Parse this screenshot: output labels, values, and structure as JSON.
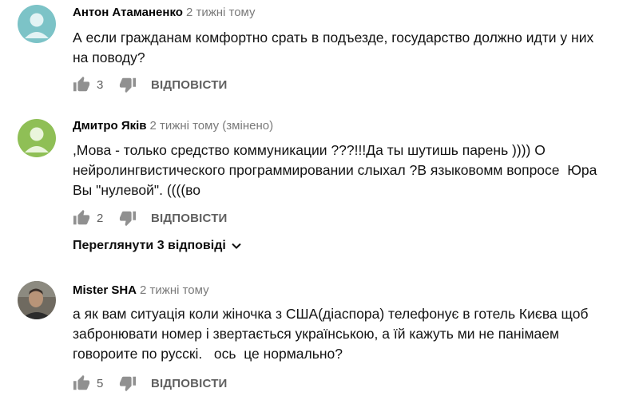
{
  "comments": [
    {
      "author": "Антон Атаманенко",
      "time": "2 тижні тому",
      "text": "А если гражданам комфортно срать в подъезде, государство должно идти у них на поводу?",
      "likes": "3",
      "reply_label": "ВІДПОВІСТИ",
      "avatar_color": "#7cc3c7"
    },
    {
      "author": "Дмитро Яків",
      "time": "2 тижні тому (змінено)",
      "text": ",Мова - только средство коммуникации ???!!!Да ты шутишь парень )))) О нейролингвистического программировании слыхал ?В языковомм вопросе  Юра Вы \"нулевой\". ((((во",
      "likes": "2",
      "reply_label": "ВІДПОВІСТИ",
      "view_replies_label": "Переглянути 3 відповіді",
      "avatar_color": "#8fbf56"
    },
    {
      "author": "Mister SHA",
      "time": "2 тижні тому",
      "text": "а як вам ситуація коли жіночка з США(діаспора) телефонує в готель Києва щоб забронювати номер і звертається українською, а їй кажуть ми не панімаем говороите по русскі.   ось  це нормально?",
      "likes": "5",
      "reply_label": "ВІДПОВІСТИ"
    }
  ],
  "icons": {
    "like": "thumbs-up-icon",
    "dislike": "thumbs-down-icon",
    "expand": "chevron-down-icon"
  }
}
